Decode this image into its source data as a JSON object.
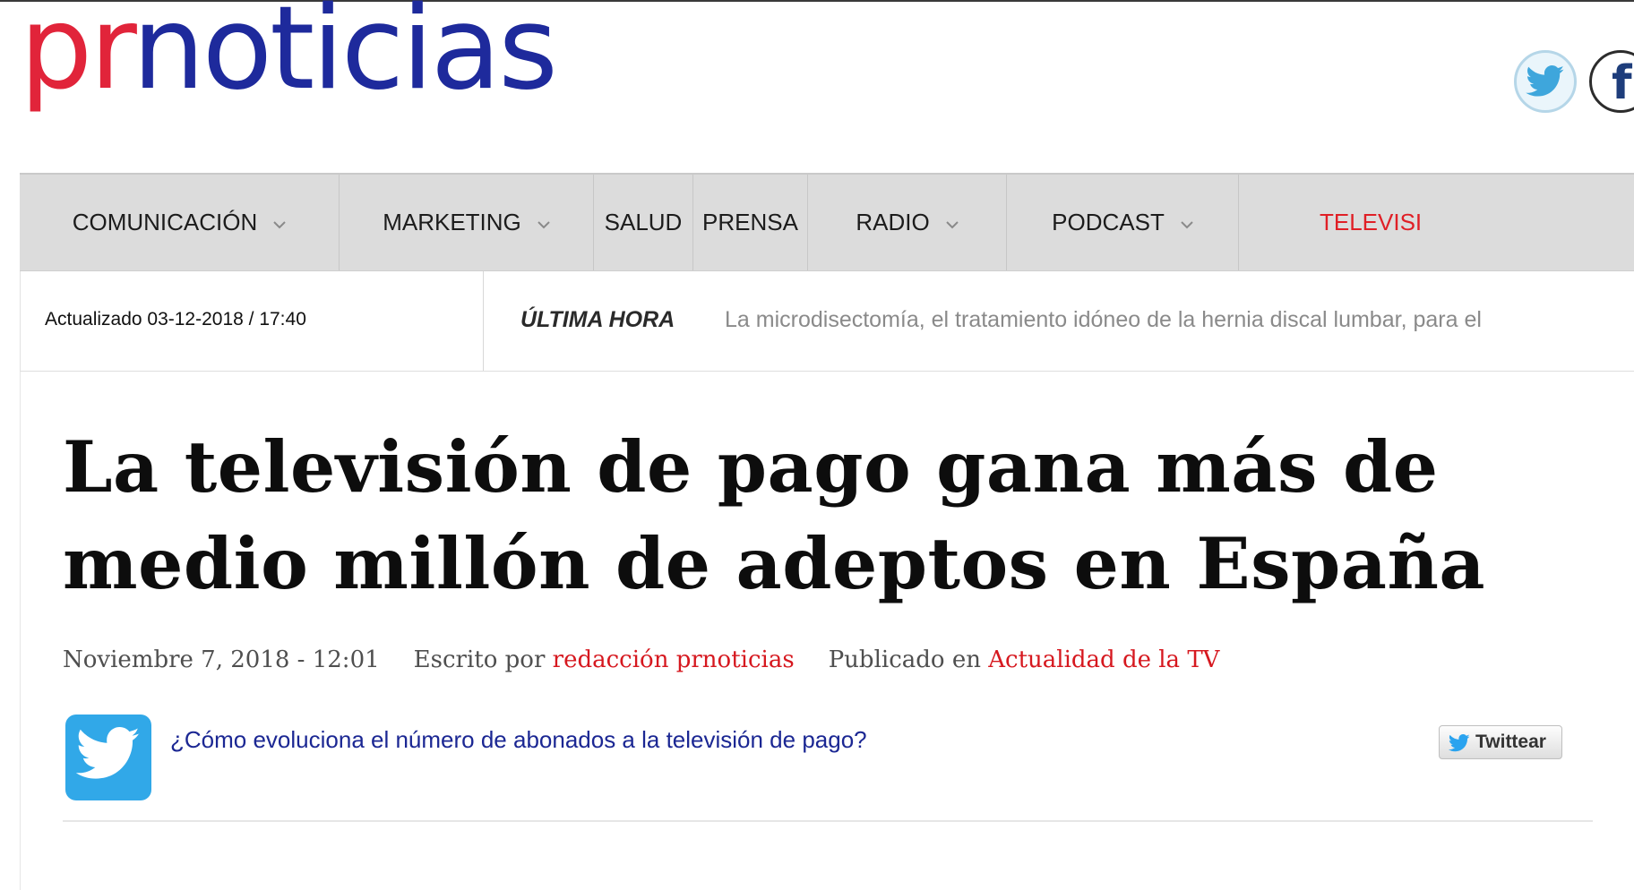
{
  "brand": {
    "logo_prefix": "pr",
    "logo_suffix": "noticias",
    "accent_red": "#e1243a",
    "accent_blue": "#1e2a9c"
  },
  "social": [
    {
      "icon": "twitter-icon"
    },
    {
      "icon": "facebook-icon",
      "glyph": "f"
    }
  ],
  "nav": {
    "items": [
      {
        "label": "COMUNICACIÓN",
        "has_dropdown": true
      },
      {
        "label": "MARKETING",
        "has_dropdown": true
      },
      {
        "label": "SALUD",
        "has_dropdown": false
      },
      {
        "label": "PRENSA",
        "has_dropdown": false
      },
      {
        "label": "RADIO",
        "has_dropdown": true
      },
      {
        "label": "PODCAST",
        "has_dropdown": true
      },
      {
        "label": "TELEVISI",
        "has_dropdown": false,
        "active": true
      }
    ]
  },
  "ticker": {
    "updated": "Actualizado 03-12-2018 / 17:40",
    "label": "ÚLTIMA HORA",
    "text": "La microdisectomía, el tratamiento idóneo de la hernia discal lumbar, para el"
  },
  "article": {
    "title_line1": "La televisión de pago gana más de",
    "title_line2": "medio millón de adeptos en España",
    "date": "Noviembre 7, 2018 - 12:01",
    "written_by_label": "Escrito por",
    "author": "redacción prnoticias",
    "published_in_label": "Publicado en",
    "category": "Actualidad de la TV",
    "tweet_question": "¿Cómo evoluciona el número de abonados a la televisión de pago?",
    "tweet_button": "Twittear"
  }
}
